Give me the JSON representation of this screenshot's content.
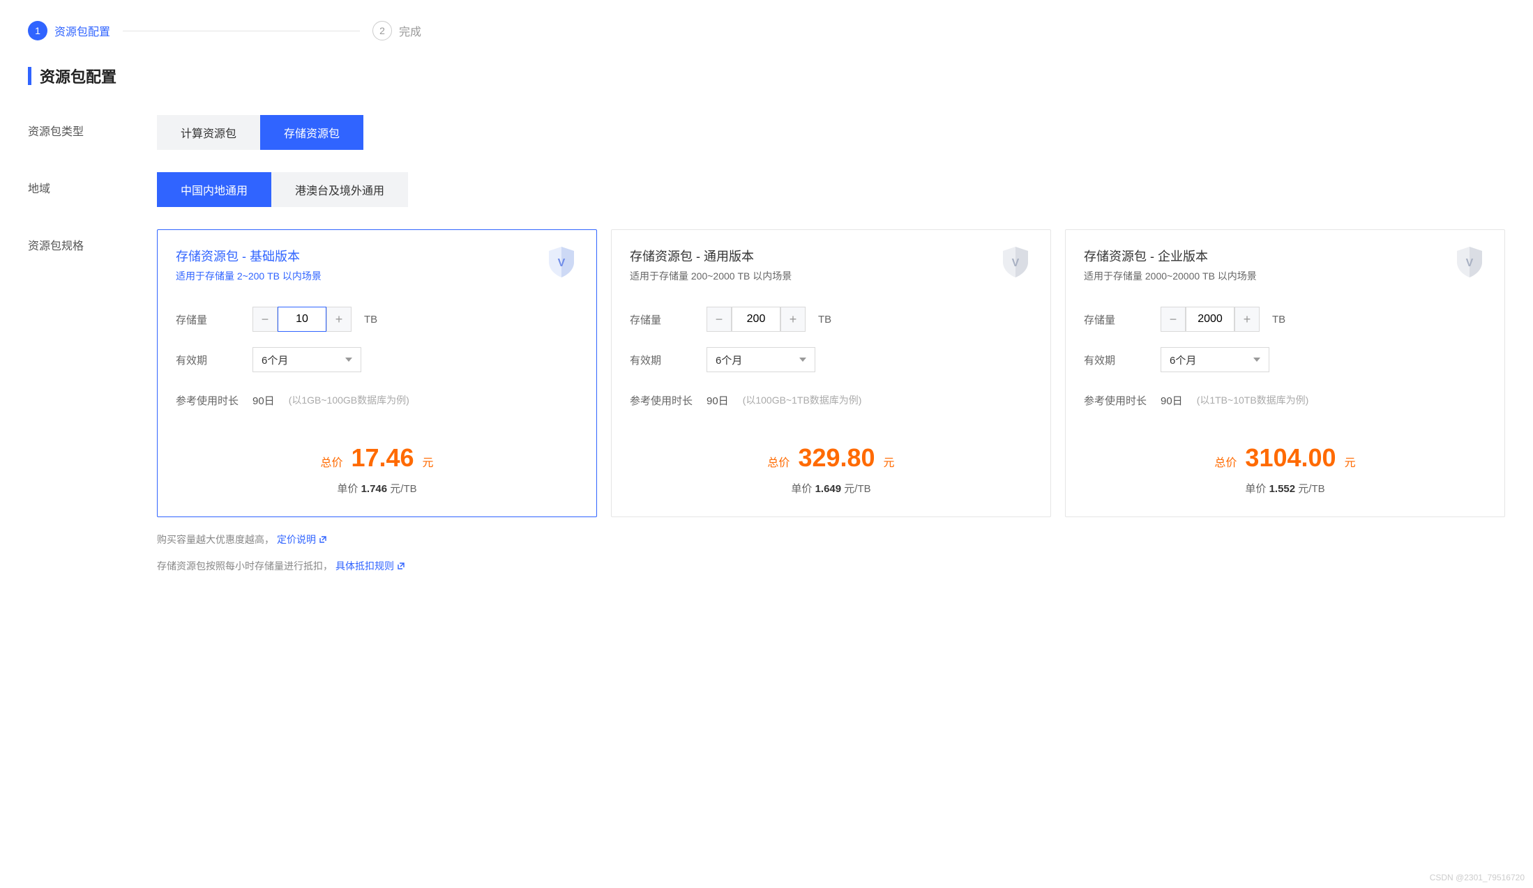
{
  "stepper": {
    "step1_num": "1",
    "step1_label": "资源包配置",
    "step2_num": "2",
    "step2_label": "完成"
  },
  "section_title": "资源包配置",
  "form": {
    "type_label": "资源包类型",
    "type_options": [
      "计算资源包",
      "存储资源包"
    ],
    "region_label": "地域",
    "region_options": [
      "中国内地通用",
      "港澳台及境外通用"
    ],
    "spec_label": "资源包规格"
  },
  "specs": [
    {
      "title": "存储资源包 - 基础版本",
      "desc": "适用于存储量 2~200 TB 以内场景",
      "storage_label": "存储量",
      "storage_val": "10",
      "unit": "TB",
      "validity_label": "有效期",
      "validity_val": "6个月",
      "ref_label": "参考使用时长",
      "ref_days": "90日",
      "ref_note": "(以1GB~100GB数据库为例)",
      "total_label": "总价",
      "total_val": "17.46",
      "total_unit": "元",
      "unit_label": "单价",
      "unit_val": "1.746",
      "unit_unit": "元/TB"
    },
    {
      "title": "存储资源包 - 通用版本",
      "desc": "适用于存储量 200~2000 TB 以内场景",
      "storage_label": "存储量",
      "storage_val": "200",
      "unit": "TB",
      "validity_label": "有效期",
      "validity_val": "6个月",
      "ref_label": "参考使用时长",
      "ref_days": "90日",
      "ref_note": "(以100GB~1TB数据库为例)",
      "total_label": "总价",
      "total_val": "329.80",
      "total_unit": "元",
      "unit_label": "单价",
      "unit_val": "1.649",
      "unit_unit": "元/TB"
    },
    {
      "title": "存储资源包 - 企业版本",
      "desc": "适用于存储量 2000~20000 TB 以内场景",
      "storage_label": "存储量",
      "storage_val": "2000",
      "unit": "TB",
      "validity_label": "有效期",
      "validity_val": "6个月",
      "ref_label": "参考使用时长",
      "ref_days": "90日",
      "ref_note": "(以1TB~10TB数据库为例)",
      "total_label": "总价",
      "total_val": "3104.00",
      "total_unit": "元",
      "unit_label": "单价",
      "unit_val": "1.552",
      "unit_unit": "元/TB"
    }
  ],
  "notes": {
    "line1_text": "购买容量越大优惠度越高，",
    "line1_link": "定价说明",
    "line2_text": "存储资源包按照每小时存储量进行抵扣，",
    "line2_link": "具体抵扣规则"
  },
  "watermark": "CSDN @2301_79516720"
}
